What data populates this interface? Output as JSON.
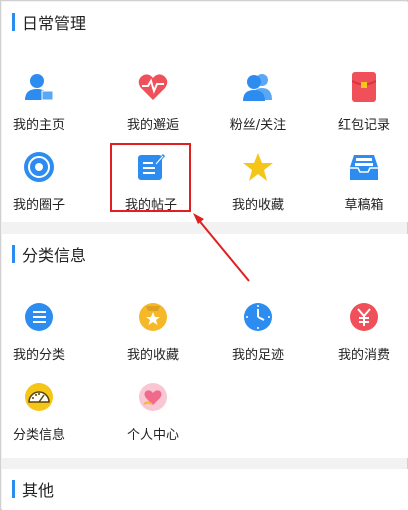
{
  "sections": {
    "daily": {
      "title": "日常管理",
      "items": [
        {
          "label": "我的主页",
          "icon": "user-home-icon",
          "color": "#2d8cf0"
        },
        {
          "label": "我的邂逅",
          "icon": "heartbeat-icon",
          "color": "#f0505a"
        },
        {
          "label": "粉丝/关注",
          "icon": "fans-icon",
          "color": "#2d8cf0"
        },
        {
          "label": "红包记录",
          "icon": "red-packet-icon",
          "color": "#f0505a"
        },
        {
          "label": "我的圈子",
          "icon": "circle-target-icon",
          "color": "#2d8cf0"
        },
        {
          "label": "我的帖子",
          "icon": "post-edit-icon",
          "color": "#2d8cf0"
        },
        {
          "label": "我的收藏",
          "icon": "star-icon",
          "color": "#f5c518"
        },
        {
          "label": "草稿箱",
          "icon": "drafts-tray-icon",
          "color": "#2d8cf0"
        }
      ]
    },
    "classified": {
      "title": "分类信息",
      "items": [
        {
          "label": "我的分类",
          "icon": "list-icon",
          "color": "#2d8cf0"
        },
        {
          "label": "我的收藏",
          "icon": "star-bag-icon",
          "color": "#f5b829"
        },
        {
          "label": "我的足迹",
          "icon": "clock-icon",
          "color": "#2d8cf0"
        },
        {
          "label": "我的消费",
          "icon": "yuan-icon",
          "color": "#f0505a"
        },
        {
          "label": "分类信息",
          "icon": "gauge-icon",
          "color": "#f5c518"
        },
        {
          "label": "个人中心",
          "icon": "heart-hand-icon",
          "color": "#f06a8c"
        }
      ]
    },
    "other": {
      "title": "其他"
    }
  },
  "accent": "#2d8cf0",
  "highlight_color": "#e02020"
}
